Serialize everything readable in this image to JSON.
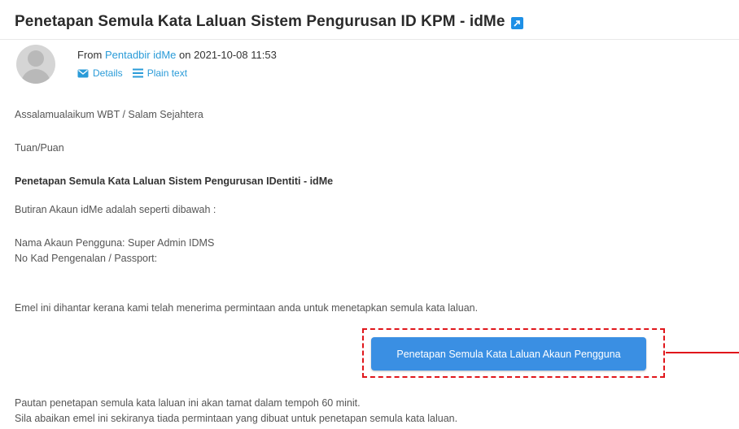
{
  "email": {
    "subject": "Penetapan Semula Kata Laluan Sistem Pengurusan ID KPM - idMe",
    "external_icon": "external-link-icon",
    "from_prefix": "From",
    "sender": "Pentadbir idMe",
    "date_prefix": "on",
    "date": "2021-10-08 11:53",
    "actions": {
      "details_label": "Details",
      "details_icon": "envelope-icon",
      "plain_text_label": "Plain text",
      "plain_text_icon": "lines-icon"
    },
    "body": {
      "greeting": "Assalamualaikum WBT / Salam Sejahtera",
      "salutation": "Tuan/Puan",
      "heading": "Penetapan Semula Kata Laluan Sistem Pengurusan IDentiti - idMe",
      "intro": "Butiran Akaun idMe adalah seperti dibawah :",
      "account_name": "Nama Akaun Pengguna: Super Admin IDMS",
      "id_number": "No Kad Pengenalan / Passport: ",
      "reason": "Emel ini dihantar kerana kami telah menerima permintaan anda untuk menetapkan semula kata laluan.",
      "cta_label": "Penetapan Semula Kata Laluan Akaun Pengguna",
      "expiry": "Pautan penetapan semula kata laluan ini akan tamat dalam tempoh 60 minit.",
      "ignore_note": "Sila abaikan emel ini sekiranya tiada permintaan yang dibuat untuk penetapan semula kata laluan."
    }
  },
  "colors": {
    "link": "#2a9bd8",
    "button": "#3a8fe3",
    "highlight": "#e0161b"
  }
}
